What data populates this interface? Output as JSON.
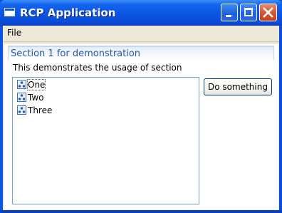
{
  "window": {
    "title": "RCP Application",
    "accent_color": "#0a55e3",
    "controls": {
      "minimize_icon": "minimize-icon",
      "maximize_icon": "maximize-icon",
      "close_icon": "close-icon"
    }
  },
  "menu": {
    "items": [
      {
        "label": "File"
      }
    ]
  },
  "section": {
    "title": "Section 1 for demonstration",
    "description": "This demonstrates the usage of section",
    "title_color": "#2a5aa0"
  },
  "tree": {
    "items": [
      {
        "label": "One",
        "icon": "node-icon"
      },
      {
        "label": "Two",
        "icon": "node-icon"
      },
      {
        "label": "Three",
        "icon": "node-icon"
      }
    ]
  },
  "action_button": {
    "label": "Do something"
  }
}
